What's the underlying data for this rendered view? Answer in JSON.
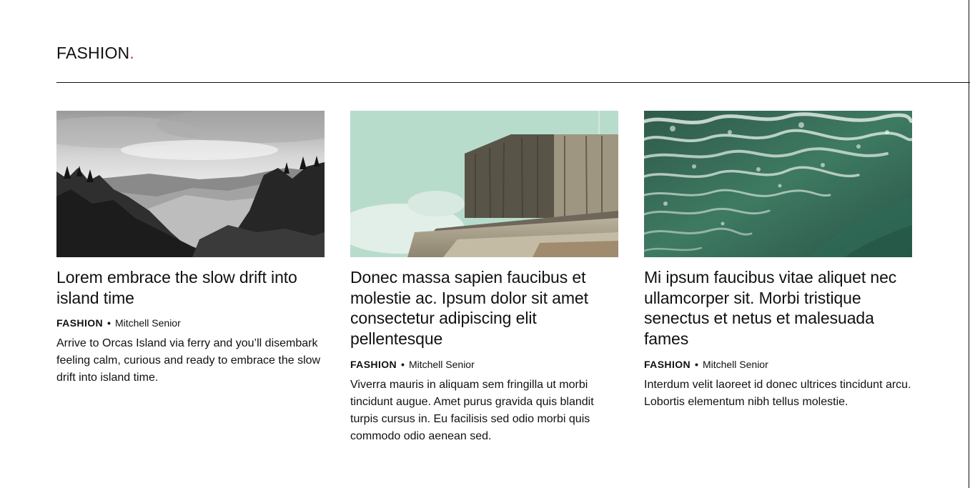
{
  "section": {
    "title": "FASHION",
    "dot": ".",
    "dot_color": "#e0224a"
  },
  "articles": [
    {
      "image_icon": "mountain-landscape-photo",
      "title": "Lorem embrace the slow drift into island time",
      "category": "FASHION",
      "separator": "•",
      "author": "Mitchell Senior",
      "excerpt": "Arrive to Orcas Island via ferry and you’ll disembark feeling calm, curious and ready to embrace the slow drift into island time."
    },
    {
      "image_icon": "concrete-building-photo",
      "title": "Donec massa sapien faucibus et molestie ac. Ipsum dolor sit amet consectetur adipiscing elit pellentesque",
      "category": "FASHION",
      "separator": "•",
      "author": "Mitchell Senior",
      "excerpt": "Viverra mauris in aliquam sem fringilla ut morbi tincidunt augue. Amet purus gravida quis blandit turpis cursus in. Eu facilisis sed odio morbi quis commodo odio aenean sed."
    },
    {
      "image_icon": "ocean-waves-photo",
      "title": "Mi ipsum faucibus vitae aliquet nec ullamcorper sit. Morbi tristique senectus et netus et malesuada fames",
      "category": "FASHION",
      "separator": "•",
      "author": "Mitchell Senior",
      "excerpt": "Interdum velit laoreet id donec ultrices tincidunt arcu. Lobortis elementum nibh tellus molestie."
    }
  ],
  "colors": {
    "text": "#111111",
    "accent": "#e0224a",
    "background": "#ffffff"
  }
}
